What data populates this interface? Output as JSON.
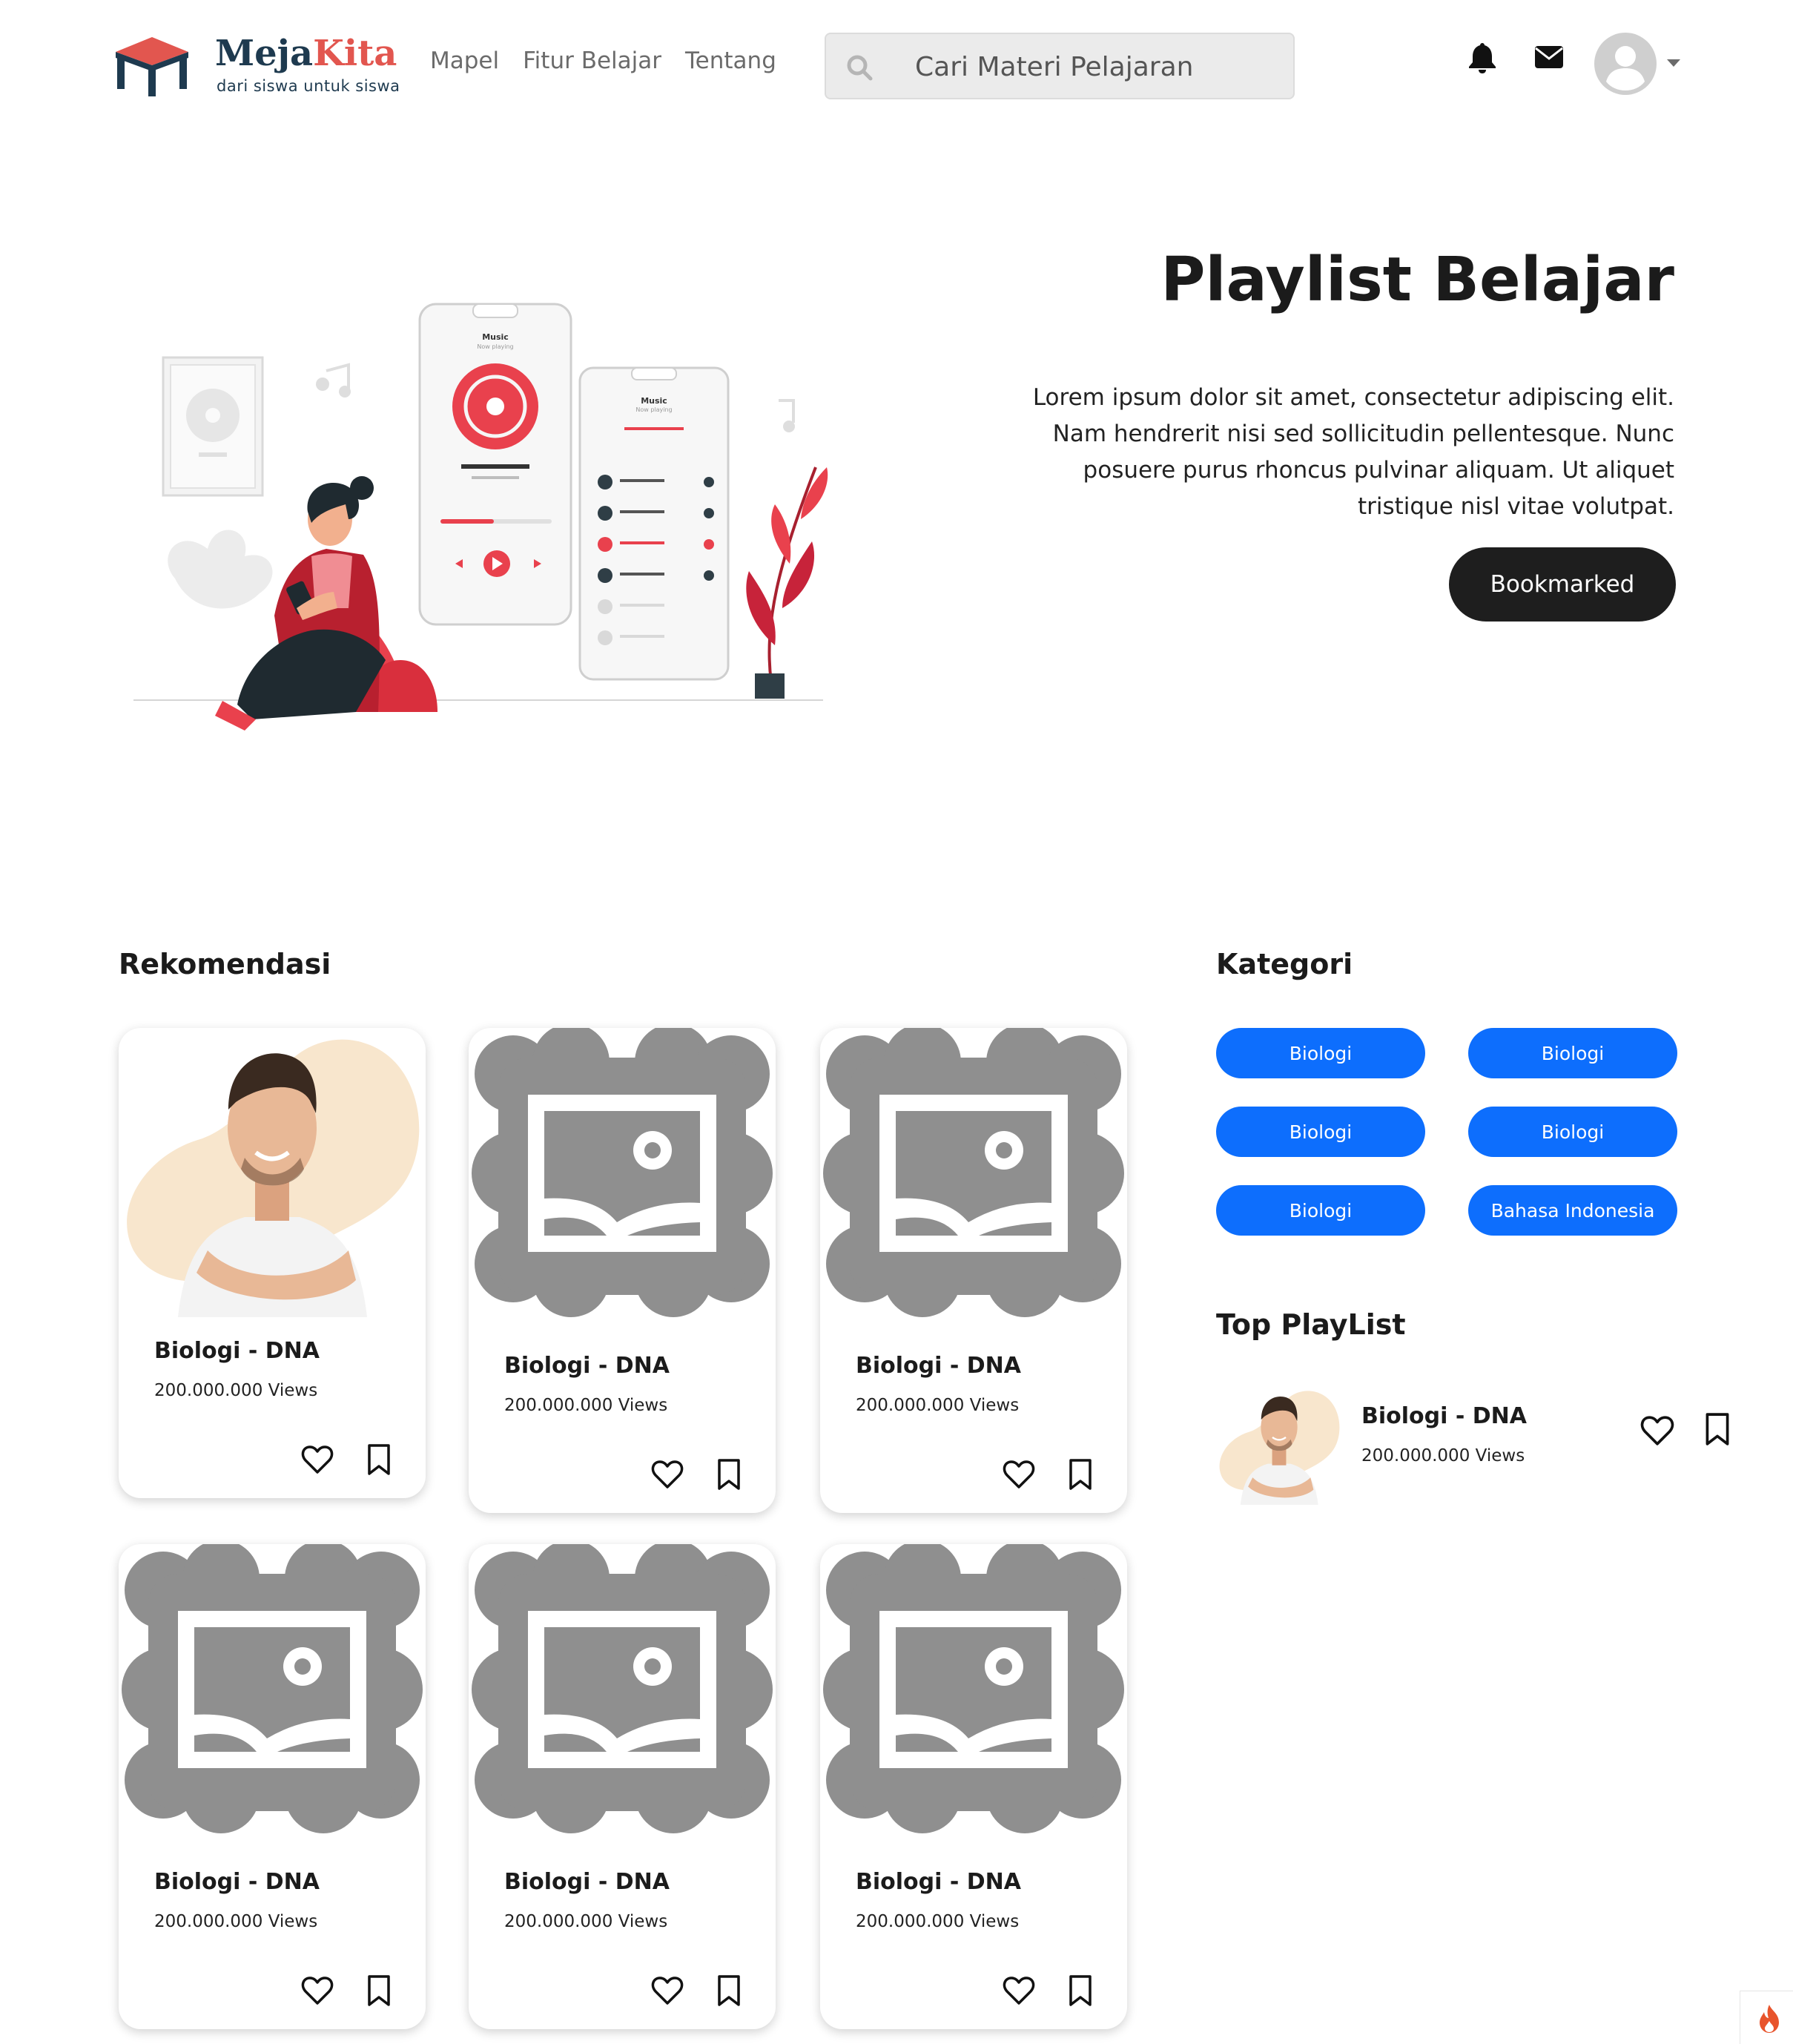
{
  "brand": {
    "name_part1": "Meja",
    "name_part2": "Kita",
    "tagline": "dari siswa untuk siswa"
  },
  "nav": {
    "items": [
      "Mapel",
      "Fitur Belajar",
      "Tentang"
    ]
  },
  "search": {
    "placeholder": "Cari Materi Pelajaran"
  },
  "hero": {
    "title": "Playlist Belajar",
    "description": "Lorem ipsum dolor sit amet, consectetur adipiscing elit. Nam hendrerit nisi sed sollicitudin pellentesque. Nunc posuere purus rhoncus pulvinar aliquam. Ut aliquet tristique nisl vitae volutpat.",
    "button_label": "Bookmarked",
    "phone_labels": {
      "title": "Music",
      "subtitle": "Now playing"
    }
  },
  "rekomendasi": {
    "heading": "Rekomendasi",
    "cards": [
      {
        "title": "Biologi - DNA",
        "views": "200.000.000 Views",
        "image": "person-photo"
      },
      {
        "title": "Biologi - DNA",
        "views": "200.000.000 Views",
        "image": "image-placeholder-icon"
      },
      {
        "title": "Biologi - DNA",
        "views": "200.000.000 Views",
        "image": "image-placeholder-icon"
      },
      {
        "title": "Biologi - DNA",
        "views": "200.000.000 Views",
        "image": "image-placeholder-icon"
      },
      {
        "title": "Biologi - DNA",
        "views": "200.000.000 Views",
        "image": "image-placeholder-icon"
      },
      {
        "title": "Biologi - DNA",
        "views": "200.000.000 Views",
        "image": "image-placeholder-icon"
      }
    ]
  },
  "kategori": {
    "heading": "Kategori",
    "items": [
      "Biologi",
      "Biologi",
      "Biologi",
      "Biologi",
      "Biologi",
      "Bahasa Indonesia"
    ]
  },
  "top_playlist": {
    "heading": "Top PlayList",
    "item": {
      "title": "Biologi - DNA",
      "views": "200.000.000 Views"
    }
  },
  "colors": {
    "brand_dark": "#1e3a4f",
    "brand_accent": "#e2564f",
    "primary_button": "#0d6efd",
    "dark_button": "#1e1e1e",
    "placeholder_gray": "#8f8f8f"
  }
}
